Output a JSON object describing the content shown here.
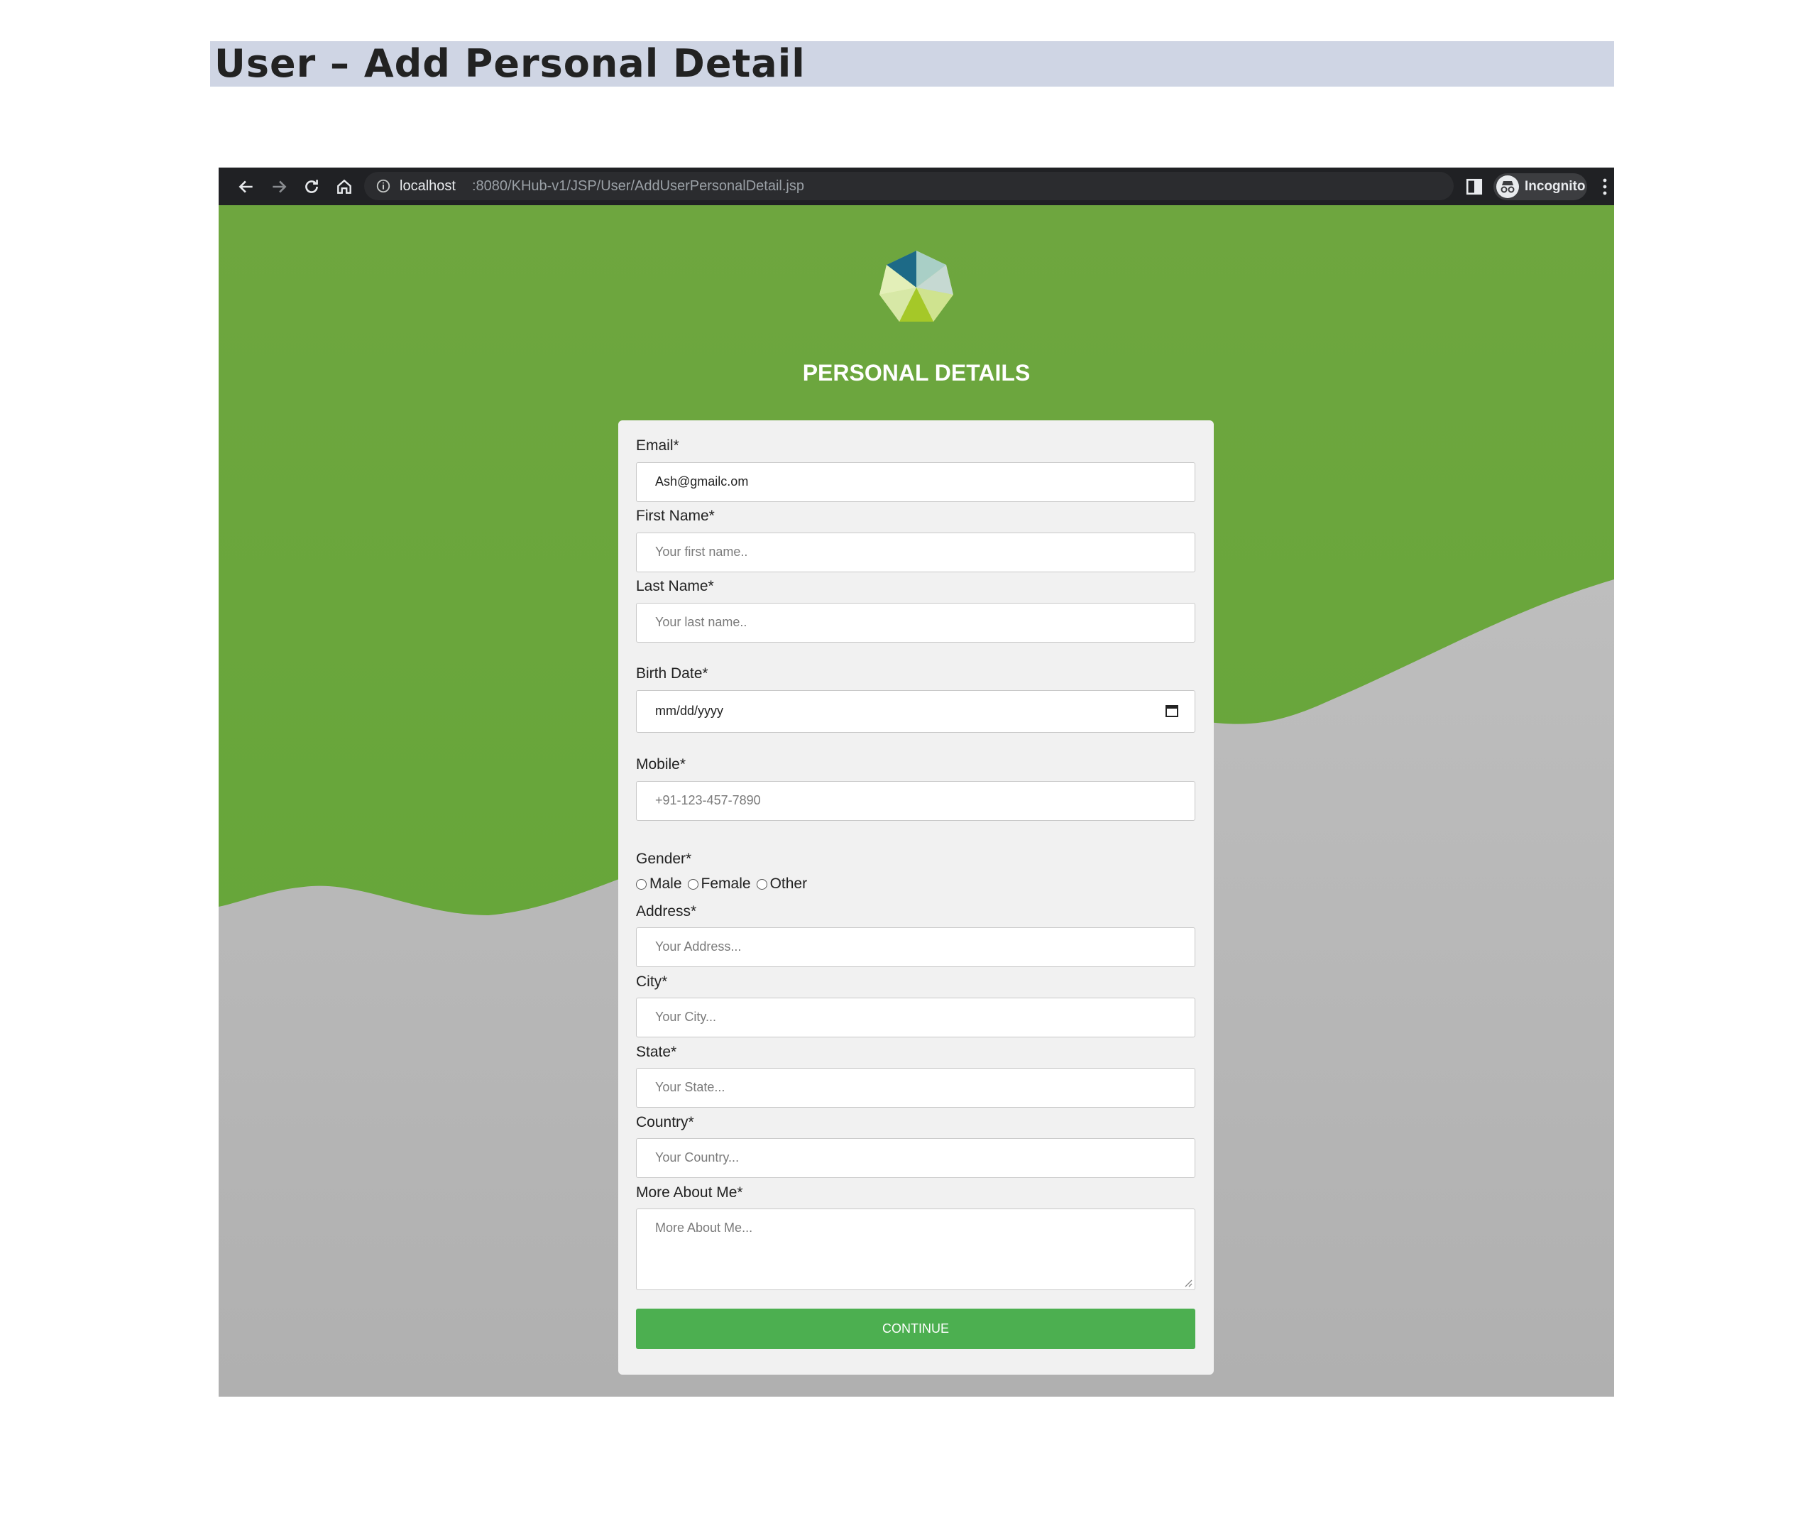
{
  "doc": {
    "heading": "User – Add Personal Detail"
  },
  "browser": {
    "url_host": "localhost",
    "url_path": ":8080/KHub-v1/JSP/User/AddUserPersonalDetail.jsp",
    "incognito_label": "Incognito",
    "icons": [
      "back-icon",
      "forward-icon",
      "reload-icon",
      "home-icon",
      "info-icon",
      "star-icon",
      "side-panel-icon",
      "incognito-icon",
      "menu-icon"
    ]
  },
  "colors": {
    "green": "#6ea63f",
    "button": "#4caf50",
    "card": "#f1f1f1",
    "chrome": "#202124"
  },
  "form": {
    "title": "PERSONAL DETAILS",
    "email": {
      "label": "Email*",
      "value": "Ash@gmailc.om"
    },
    "first_name": {
      "label": "First Name*",
      "placeholder": "Your first name.."
    },
    "last_name": {
      "label": "Last Name*",
      "placeholder": "Your last name.."
    },
    "birth_date": {
      "label": "Birth Date*",
      "placeholder": "mm/dd/yyyy"
    },
    "mobile": {
      "label": "Mobile*",
      "placeholder": "+91-123-457-7890"
    },
    "gender": {
      "label": "Gender*",
      "options": [
        "Male",
        "Female",
        "Other"
      ]
    },
    "address": {
      "label": "Address*",
      "placeholder": "Your Address..."
    },
    "city": {
      "label": "City*",
      "placeholder": "Your City..."
    },
    "state": {
      "label": "State*",
      "placeholder": "Your State..."
    },
    "country": {
      "label": "Country*",
      "placeholder": "Your Country..."
    },
    "about": {
      "label": "More About Me*",
      "placeholder": "More About Me..."
    },
    "continue_label": "CONTINUE"
  }
}
